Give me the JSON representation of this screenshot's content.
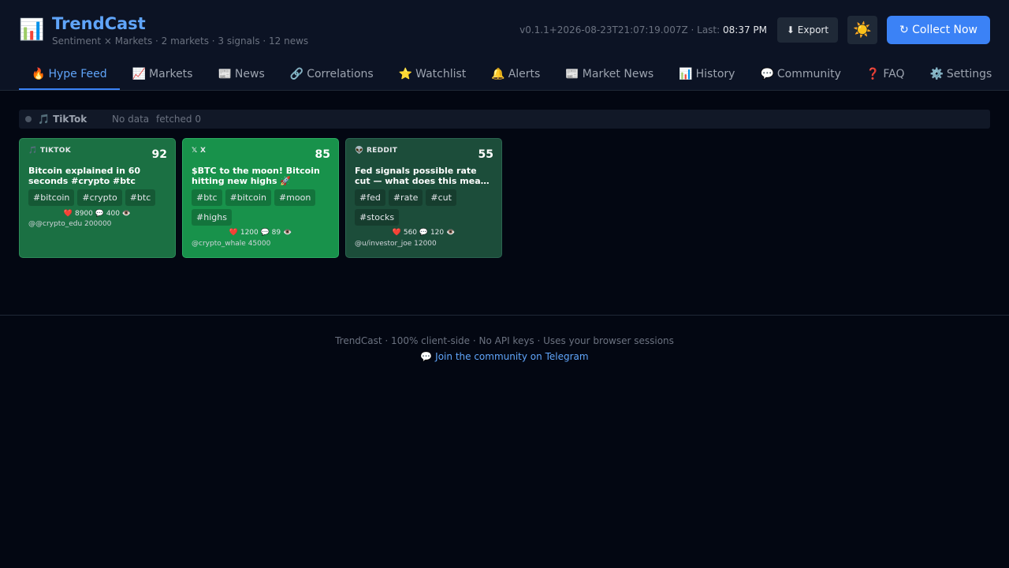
{
  "app": {
    "logo_icon": "📊",
    "title": "TrendCast",
    "subtitle": "Sentiment × Markets · 2 markets · 3 signals · 12 news",
    "version_text": "v0.1.1+2026-08-23T21:07:19.007Z · Last:",
    "last_time": "08:37 PM"
  },
  "toolbar": {
    "export_label": "⬇ Export",
    "theme_icon": "☀️",
    "collect_label": "↻ Collect Now"
  },
  "tabs": [
    {
      "icon": "🔥",
      "label": "Hype Feed",
      "active": true
    },
    {
      "icon": "📈",
      "label": "Markets"
    },
    {
      "icon": "📰",
      "label": "News"
    },
    {
      "icon": "🔗",
      "label": "Correlations"
    },
    {
      "icon": "⭐",
      "label": "Watchlist"
    },
    {
      "icon": "🔔",
      "label": "Alerts"
    },
    {
      "icon": "📰",
      "label": "Market News"
    },
    {
      "icon": "📊",
      "label": "History"
    },
    {
      "icon": "💬",
      "label": "Community"
    },
    {
      "icon": "❓",
      "label": "FAQ"
    },
    {
      "icon": "⚙️",
      "label": "Settings"
    }
  ],
  "source": {
    "name": "🎵 TikTok",
    "status": "No data",
    "fetched": "fetched 0"
  },
  "cards": [
    {
      "platform": "🎵 TIKTOK",
      "score": "92",
      "title": "Bitcoin explained in 60 seconds #crypto #btc",
      "tags": [
        "#bitcoin",
        "#crypto",
        "#btc"
      ],
      "stats": "❤️ 8900 💬 400 👁️",
      "author": "@@crypto_edu 200000"
    },
    {
      "platform": "𝕏 X",
      "score": "85",
      "title": "$BTC to the moon! Bitcoin hitting new highs 🚀",
      "tags": [
        "#btc",
        "#bitcoin",
        "#moon",
        "#highs"
      ],
      "stats": "❤️ 1200 💬 89 👁️",
      "author": "@crypto_whale 45000"
    },
    {
      "platform": "👽 REDDIT",
      "score": "55",
      "title": "Fed signals possible rate cut — what does this mea…",
      "tags": [
        "#fed",
        "#rate",
        "#cut",
        "#stocks"
      ],
      "stats": "❤️ 560 💬 120 👁️",
      "author": "@u/investor_joe 12000"
    }
  ],
  "footer": {
    "text": "TrendCast · 100% client-side · No API keys · Uses your browser sessions",
    "link": "💬 Join the community on Telegram"
  }
}
